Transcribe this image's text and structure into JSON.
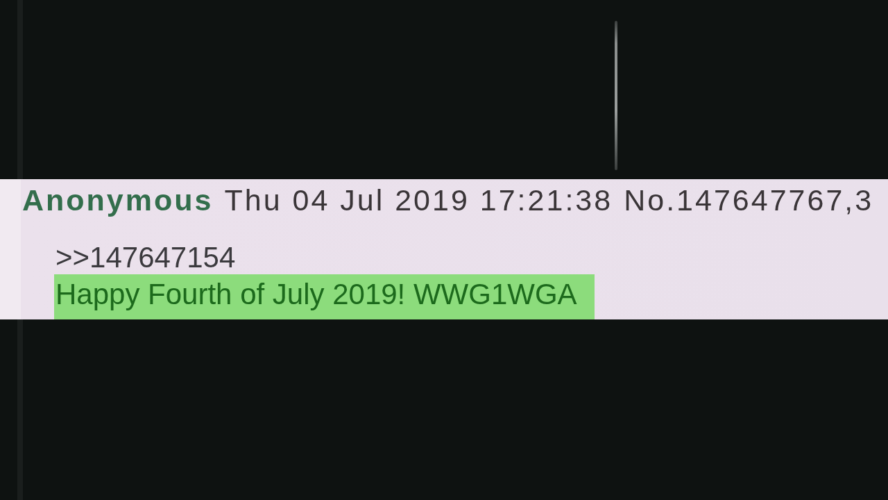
{
  "post": {
    "name": "Anonymous",
    "datetime": "Thu 04 Jul 2019 17:21:38",
    "post_number": "No.147647767,3",
    "reply_link": ">>147647154",
    "message": {
      "text": "Happy Fourth of July 2019! WWG1WGA",
      "highlighted": true
    }
  }
}
